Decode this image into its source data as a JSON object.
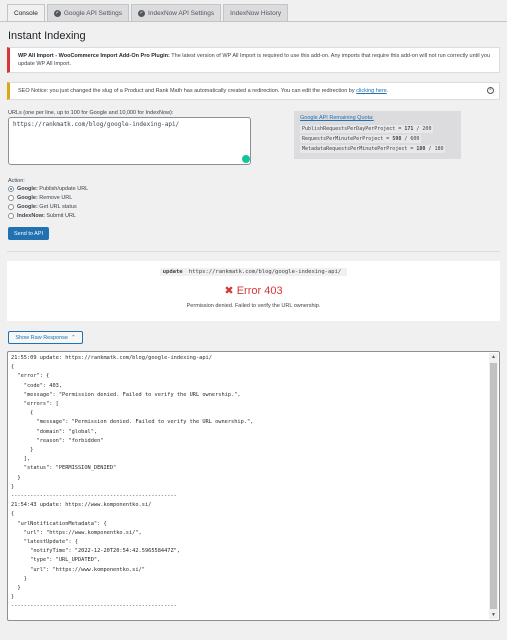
{
  "tabs": [
    {
      "label": "Console",
      "icon": ""
    },
    {
      "label": "Google API Settings",
      "icon": "check-circle-icon"
    },
    {
      "label": "IndexNow API Settings",
      "icon": "check-circle-icon"
    },
    {
      "label": "IndexNow History",
      "icon": ""
    }
  ],
  "page_title": "Instant Indexing",
  "notice_error": {
    "bold": "WP All Import - WooCommerce Import Add-On Pro Plugin:",
    "text": " The latest version of WP All Import is required to use this add-on. Any imports that require this add-on will not run correctly until you update WP All Import."
  },
  "notice_seo": {
    "text": "SEO Notice: you just changed the slug of a Product and Rank Math has automatically created a redirection. You can edit the redirection by ",
    "link": "clicking here",
    "end": "."
  },
  "urls": {
    "label": "URLs (one per line, up to 100 for Google and 10,000 for IndexNow):",
    "value": "https://rankmatk.com/blog/google-indexing-api/"
  },
  "quota": {
    "title": "Google API Remaining Quota:",
    "rows": [
      {
        "name": "PublishRequestsPerDayPerProject",
        "sep": " = ",
        "used": "171",
        "total": " / 200"
      },
      {
        "name": "RequestsPerMinutePerProject",
        "sep": " = ",
        "used": "598",
        "total": " / 600"
      },
      {
        "name": "MetadataRequestsPerMinutePerProject",
        "sep": " = ",
        "used": "180",
        "total": " / 180"
      }
    ]
  },
  "action": {
    "label": "Action:",
    "options": [
      {
        "bold": "Google:",
        "text": " Publish/update URL",
        "checked": true
      },
      {
        "bold": "Google:",
        "text": " Remove URL",
        "checked": false
      },
      {
        "bold": "Google:",
        "text": " Get URL status",
        "checked": false
      },
      {
        "bold": "IndexNow:",
        "text": " Submit URL",
        "checked": false
      }
    ],
    "send_label": "Send to API"
  },
  "result": {
    "update_word": "update",
    "url": "https://rankmatk.com/blog/google-indexing-api/",
    "error": "Error 403",
    "message": "Permission denied. Failed to verify the URL ownership."
  },
  "raw_button": "Show Raw Response",
  "raw_lines": [
    "21:55:09 update: https://rankmatk.com/blog/google-indexing-api/",
    "{",
    "  \"error\": {",
    "    \"code\": 403,",
    "    \"message\": \"Permission denied. Failed to verify the URL ownership.\",",
    "    \"errors\": [",
    "      {",
    "        \"message\": \"Permission denied. Failed to verify the URL ownership.\",",
    "        \"domain\": \"global\",",
    "        \"reason\": \"forbidden\"",
    "      }",
    "    ],",
    "    \"status\": \"PERMISSION_DENIED\"",
    "  }",
    "}",
    "----------------------------------------------------",
    "21:54:43 update: https://www.komponentko.si/",
    "{",
    "  \"urlNotificationMetadata\": {",
    "    \"url\": \"https://www.komponentko.si/\",",
    "    \"latestUpdate\": {",
    "      \"notifyTime\": \"2022-12-20T20:54:42.596558447Z\",",
    "      \"type\": \"URL_UPDATED\",",
    "      \"url\": \"https://www.komponentko.si/\"",
    "    }",
    "  }",
    "}",
    "----------------------------------------------------"
  ]
}
